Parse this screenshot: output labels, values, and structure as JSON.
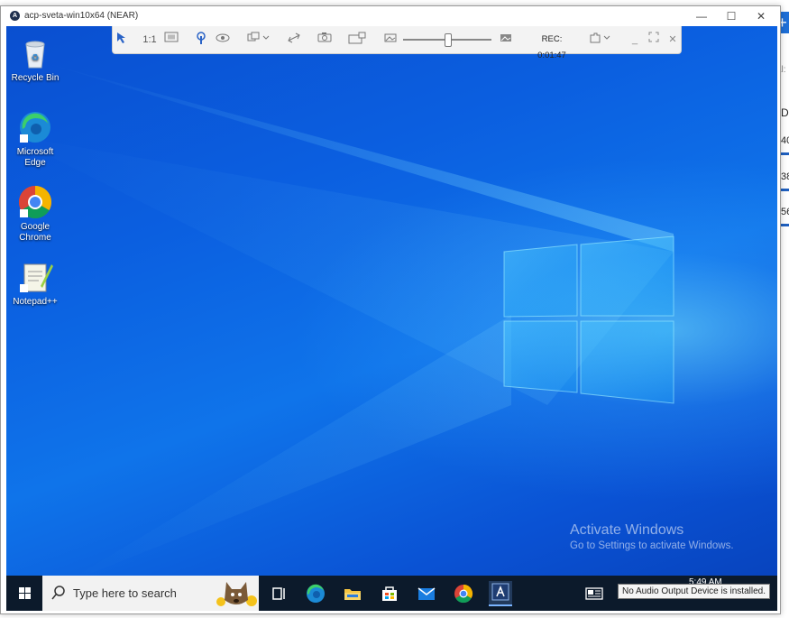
{
  "background_app": {
    "fragments": [
      "d",
      "a",
      "T",
      "al: ",
      "D",
      "40",
      "38",
      "56"
    ],
    "plus_label": "+"
  },
  "window": {
    "title": "acp-sveta-win10x64 (NEAR)",
    "app_icon_letter": "A",
    "controls": {
      "minimize": "—",
      "maximize": "☐",
      "close": "✕"
    }
  },
  "toolbar": {
    "scale_label": "1:1",
    "rec_label": "REC: 0:01:47"
  },
  "desktop": {
    "icons": [
      {
        "label_lines": [
          "Recycle Bin"
        ]
      },
      {
        "label_lines": [
          "Microsoft",
          "Edge"
        ]
      },
      {
        "label_lines": [
          "Google",
          "Chrome"
        ]
      },
      {
        "label_lines": [
          "Notepad++"
        ]
      }
    ],
    "watermark": {
      "title": "Activate Windows",
      "subtitle": "Go to Settings to activate Windows."
    }
  },
  "taskbar": {
    "search_placeholder": "Type here to search",
    "time": "5:49 AM",
    "tooltip": "No Audio Output Device is installed."
  },
  "colors": {
    "desktop_blue": "#0b5fe0",
    "taskbar": "#0c1a2b",
    "accent_blue": "#1f6fd6"
  }
}
